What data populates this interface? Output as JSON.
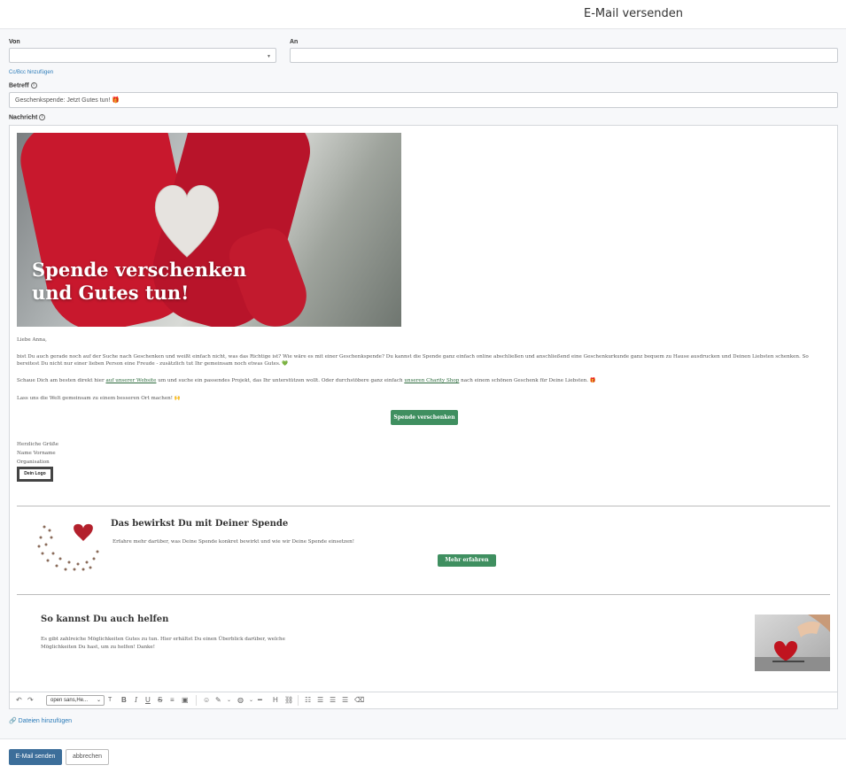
{
  "header": {
    "title": "E-Mail versenden"
  },
  "form": {
    "from_label": "Von",
    "to_label": "An",
    "cc_link": "Cc/Bcc hinzufügen",
    "subject_label": "Betreff",
    "subject_value": "Geschenkspende: Jetzt Gutes tun! 🎁",
    "message_label": "Nachricht"
  },
  "email": {
    "hero_title_line1": "Spende verschenken",
    "hero_title_line2": "und Gutes tun!",
    "greeting": "Liebe Anna,",
    "para1": "bist Du auch gerade noch auf der Suche nach Geschenken und weißt einfach nicht, was das Richtige ist? Wie wäre es mit einer Geschenkspende? Du kannst die Spende ganz einfach online abschließen und anschließend eine Geschenkurkunde ganz bequem zu Hause ausdrucken und Deinen Liebsten schenken. So bereitest Du nicht nur einer lieben Person eine Freude - zusätzlich tut Ihr gemeinsam noch etwas Gutes. 💚",
    "para2_a": "Schaue Dich am besten direkt hier ",
    "para2_link1": "auf unserer Website",
    "para2_b": " um und suche ein passendes Projekt, das Ihr unterstützen wollt. Oder durchstöbere ganz einfach ",
    "para2_link2": "unseren Charity Shop",
    "para2_c": " nach einem schönen Geschenk für Deine Liebsten. 🎁",
    "para3": "Lass uns die Welt gemeinsam zu einem besseren Ort machen! 🙌",
    "cta_button": "Spende verschenken",
    "sign1": "Herzliche Grüße",
    "sign2": "Name Vorname",
    "sign3": "Organisation",
    "logo": "Dein Logo",
    "section1_title": "Das bewirkst Du mit Deiner Spende",
    "section1_text": "Erfahre mehr darüber, was Deine Spende konkret bewirkt und wie wir Deine Spende einsetzen!",
    "section1_button": "Mehr erfahren",
    "section2_title": "So kannst Du auch helfen",
    "section2_text1": "Es gibt zahlreiche Möglichkeiten Gutes zu tun. Hier erhältst Du einen Überblick darüber, welche",
    "section2_text2": "Möglichkeiten Du hast, um zu helfen! Danke!"
  },
  "toolbar": {
    "undo": "↶",
    "redo": "↷",
    "font": "open sans,He...",
    "font_size": "T",
    "bold": "B",
    "italic": "I",
    "underline": "U",
    "strike": "S",
    "heading": "H"
  },
  "attach_link": "Dateien hinzufügen",
  "footer": {
    "send": "E-Mail senden",
    "cancel": "abbrechen"
  },
  "colors": {
    "primary": "#3c6e9a",
    "green": "#3f8f60",
    "hero_red": "#c8182d"
  }
}
